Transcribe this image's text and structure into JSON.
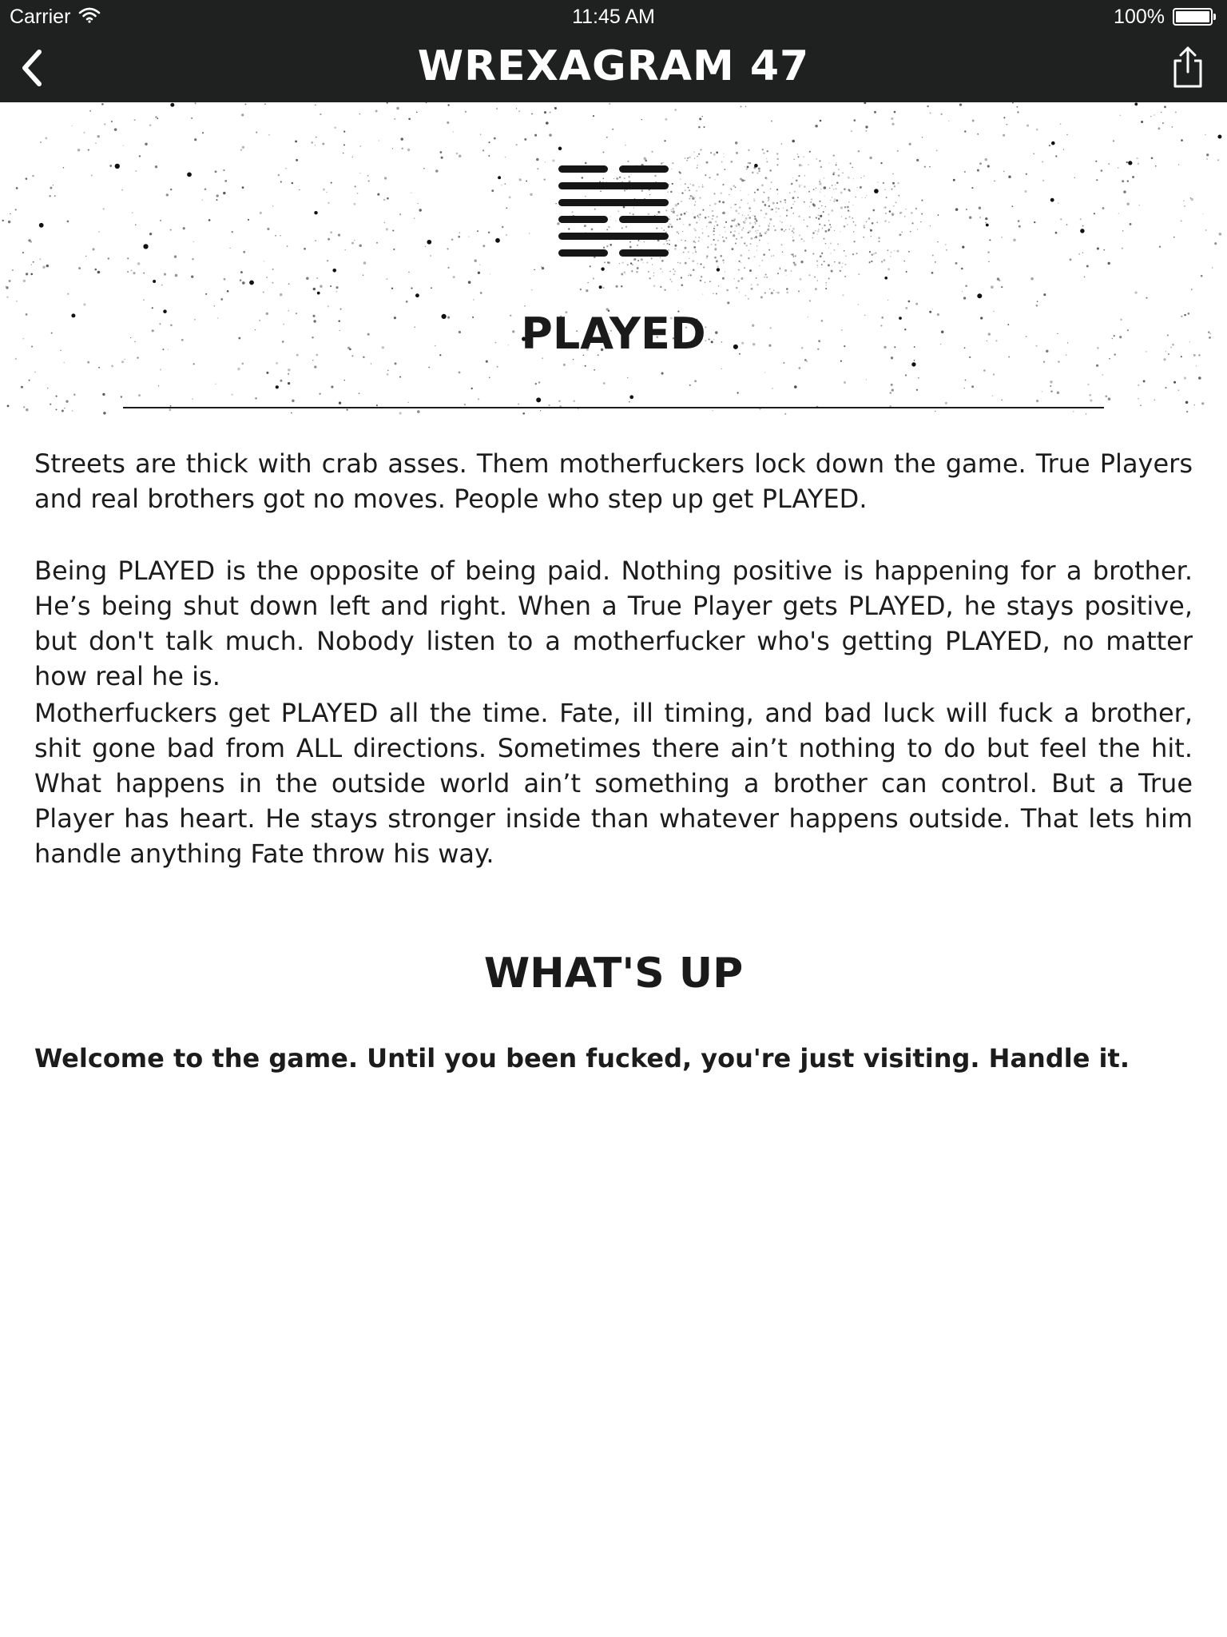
{
  "status_bar": {
    "carrier": "Carrier",
    "time": "11:45 AM",
    "battery_text": "100%",
    "battery_level": 1.0
  },
  "nav": {
    "title": "WREXAGRAM 47",
    "back_icon": "chevron-left-icon",
    "share_icon": "share-icon"
  },
  "hero": {
    "title": "PLAYED",
    "hexagram_icon": "hexagram-icon"
  },
  "body": {
    "paragraphs": [
      "Streets are thick with crab asses. Them motherfuckers lock down the game. True Players and real brothers got no moves. People who step up get PLAYED.",
      "Being PLAYED is the opposite of being paid. Nothing positive is happening for a brother. He’s being shut down left and right. When a True Player gets PLAYED, he stays positive, but don't talk much. Nobody listen to a motherfucker who's getting PLAYED, no matter how real he is.",
      "Motherfuckers get PLAYED all the time. Fate, ill timing, and bad luck will fuck a brother, shit gone bad from ALL directions. Sometimes there ain’t nothing to do but feel the hit. What happens in the outside world ain’t something a brother can control. But a True Player has heart. He stays stronger inside than whatever happens outside. That lets him handle anything Fate throw his way."
    ]
  },
  "whats_up": {
    "heading": "WHAT'S UP",
    "text": "Welcome to the game. Until you been fucked, you're just visiting. Handle it."
  },
  "colors": {
    "nav_background": "#1f2121",
    "text": "#1c1c1c",
    "page_background": "#ffffff"
  }
}
